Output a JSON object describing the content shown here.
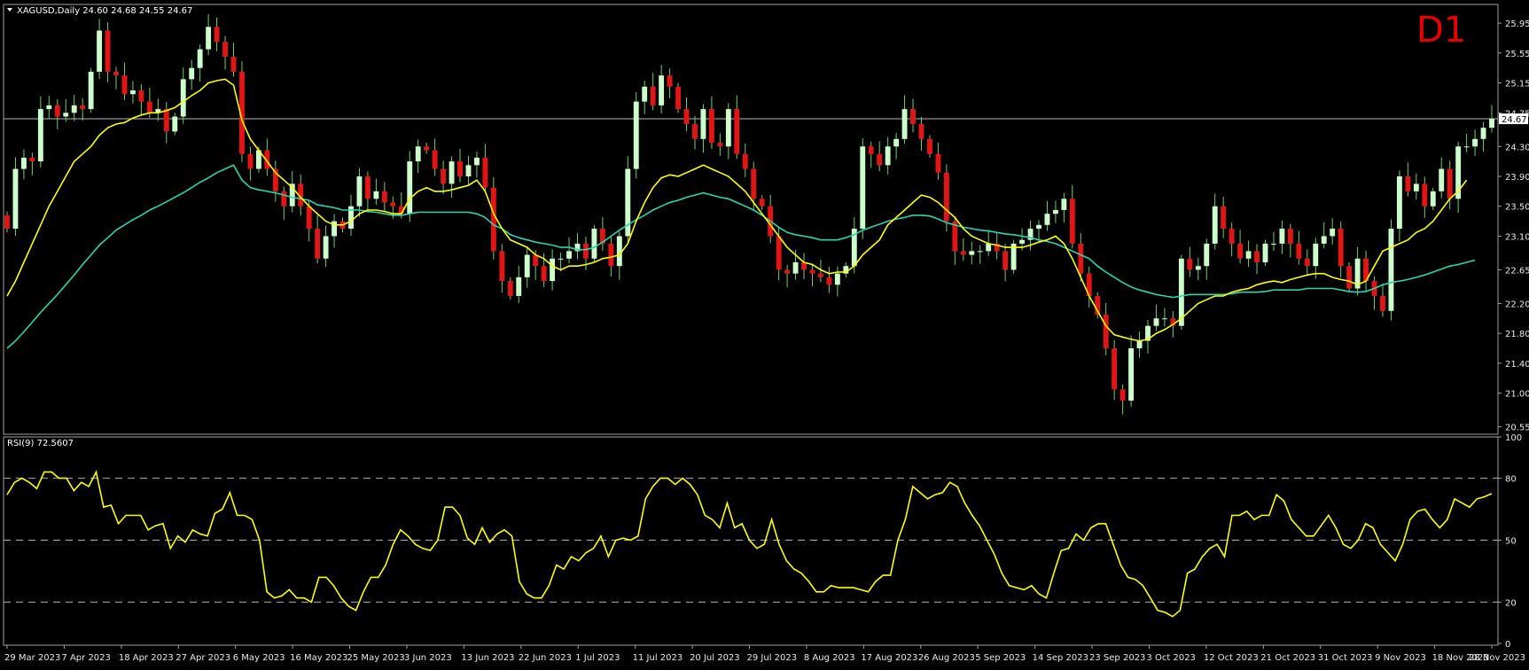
{
  "header": {
    "symbol_line": "XAGUSD,Daily  24.60 24.68 24.55 24.67",
    "timeframe_badge": "D1",
    "rsi_label": "RSI(9) 72.5607",
    "last_price_label": "24.67"
  },
  "colors": {
    "bull_candle": "#ccffcc",
    "bear_candle": "#e31414",
    "wick": "#6fd06f",
    "ma_fast": "#ffff00",
    "ma_slow": "#29d6b0",
    "rsi_line": "#ffff00",
    "frame": "#a0a0a0"
  },
  "chart_data": [
    {
      "type": "candlestick",
      "symbol": "XAGUSD",
      "timeframe": "Daily",
      "ylim": [
        20.45,
        26.2
      ],
      "y_ticks": [
        "25.95",
        "25.55",
        "25.15",
        "24.75",
        "24.30",
        "23.90",
        "23.50",
        "23.10",
        "22.65",
        "22.20",
        "21.80",
        "21.40",
        "21.00",
        "20.55"
      ],
      "last_price": 24.67,
      "x_tick_labels": [
        "29 Mar 2023",
        "7 Apr 2023",
        "18 Apr 2023",
        "27 Apr 2023",
        "6 May 2023",
        "16 May 2023",
        "25 May 2023",
        "3 Jun 2023",
        "13 Jun 2023",
        "22 Jun 2023",
        "1 Jul 2023",
        "11 Jul 2023",
        "20 Jul 2023",
        "29 Jul 2023",
        "8 Aug 2023",
        "17 Aug 2023",
        "26 Aug 2023",
        "5 Sep 2023",
        "14 Sep 2023",
        "23 Sep 2023",
        "3 Oct 2023",
        "12 Oct 2023",
        "21 Oct 2023",
        "31 Oct 2023",
        "9 Nov 2023",
        "18 Nov 2023",
        "28 Nov 2023"
      ],
      "close": [
        23.2,
        24.0,
        24.15,
        24.1,
        24.8,
        24.85,
        24.7,
        24.75,
        24.85,
        24.8,
        25.3,
        25.85,
        25.3,
        25.25,
        25.0,
        25.05,
        24.9,
        24.75,
        24.8,
        24.5,
        24.7,
        25.2,
        25.35,
        25.6,
        25.9,
        25.7,
        25.5,
        25.3,
        24.2,
        24.0,
        24.25,
        24.0,
        23.7,
        23.5,
        23.8,
        23.5,
        23.2,
        22.8,
        23.1,
        23.3,
        23.2,
        23.5,
        23.9,
        23.6,
        23.7,
        23.55,
        23.5,
        23.4,
        24.1,
        24.3,
        24.25,
        24.0,
        23.8,
        24.1,
        23.9,
        24.05,
        24.15,
        23.75,
        22.9,
        22.5,
        22.3,
        22.55,
        22.85,
        22.7,
        22.5,
        22.8,
        22.8,
        22.9,
        23.0,
        22.8,
        23.2,
        23.0,
        22.7,
        23.1,
        24.0,
        24.9,
        25.1,
        24.85,
        25.25,
        25.1,
        24.8,
        24.6,
        24.4,
        24.8,
        24.35,
        24.3,
        24.8,
        24.2,
        24.0,
        23.6,
        23.5,
        23.1,
        22.65,
        22.6,
        22.75,
        22.65,
        22.6,
        22.55,
        22.45,
        22.6,
        22.7,
        23.2,
        24.3,
        24.2,
        24.05,
        24.3,
        24.4,
        24.8,
        24.6,
        24.4,
        24.2,
        23.95,
        23.3,
        22.9,
        22.85,
        22.9,
        22.9,
        23.0,
        22.9,
        22.65,
        23.0,
        23.05,
        23.2,
        23.25,
        23.4,
        23.45,
        23.6,
        23.0,
        22.6,
        22.3,
        22.05,
        21.6,
        21.05,
        20.9,
        21.6,
        21.7,
        21.9,
        22.0,
        22.0,
        21.9,
        22.8,
        22.65,
        22.7,
        23.0,
        23.5,
        23.2,
        23.0,
        22.8,
        22.9,
        22.75,
        23.0,
        23.0,
        23.2,
        23.0,
        22.8,
        22.7,
        23.0,
        23.1,
        23.2,
        22.7,
        22.4,
        22.8,
        22.5,
        22.3,
        22.1,
        23.2,
        23.9,
        23.7,
        23.8,
        23.5,
        23.7,
        24.0,
        23.6,
        24.3,
        24.3,
        24.4,
        24.55,
        24.67
      ],
      "ma_fast_values": [
        22.3,
        22.5,
        22.75,
        23.0,
        23.25,
        23.5,
        23.7,
        23.9,
        24.1,
        24.2,
        24.3,
        24.45,
        24.55,
        24.6,
        24.62,
        24.68,
        24.72,
        24.75,
        24.75,
        24.78,
        24.82,
        24.9,
        24.98,
        25.05,
        25.15,
        25.18,
        25.2,
        25.12,
        24.65,
        24.4,
        24.25,
        24.1,
        23.95,
        23.85,
        23.75,
        23.62,
        23.5,
        23.4,
        23.3,
        23.25,
        23.25,
        23.3,
        23.4,
        23.45,
        23.45,
        23.43,
        23.4,
        23.4,
        23.6,
        23.7,
        23.75,
        23.7,
        23.7,
        23.72,
        23.75,
        23.78,
        23.85,
        23.7,
        23.4,
        23.2,
        23.05,
        23.0,
        22.95,
        22.85,
        22.8,
        22.7,
        22.65,
        22.7,
        22.7,
        22.72,
        22.75,
        22.8,
        22.82,
        22.85,
        23.0,
        23.3,
        23.55,
        23.75,
        23.88,
        23.92,
        23.9,
        23.95,
        24.0,
        24.05,
        24.0,
        23.95,
        23.9,
        23.8,
        23.7,
        23.55,
        23.4,
        23.25,
        23.1,
        22.95,
        22.85,
        22.75,
        22.72,
        22.65,
        22.6,
        22.62,
        22.62,
        22.7,
        22.85,
        22.95,
        23.05,
        23.25,
        23.35,
        23.45,
        23.55,
        23.65,
        23.62,
        23.55,
        23.45,
        23.35,
        23.2,
        23.1,
        23.05,
        23.0,
        22.98,
        22.95,
        22.95,
        22.95,
        22.98,
        23.02,
        23.05,
        23.1,
        23.0,
        22.8,
        22.55,
        22.3,
        22.1,
        21.9,
        21.78,
        21.75,
        21.72,
        21.7,
        21.72,
        21.8,
        21.85,
        21.92,
        22.0,
        22.1,
        22.2,
        22.25,
        22.3,
        22.3,
        22.35,
        22.38,
        22.4,
        22.45,
        22.48,
        22.5,
        22.48,
        22.52,
        22.55,
        22.58,
        22.6,
        22.6,
        22.55,
        22.52,
        22.5,
        22.45,
        22.5,
        22.7,
        22.9,
        22.95,
        23.0,
        23.05,
        23.15,
        23.2,
        23.3,
        23.45,
        23.6,
        23.7,
        23.85
      ],
      "ma_slow_values": [
        21.6,
        21.7,
        21.82,
        21.95,
        22.08,
        22.2,
        22.32,
        22.45,
        22.58,
        22.72,
        22.85,
        22.98,
        23.08,
        23.18,
        23.25,
        23.32,
        23.38,
        23.45,
        23.5,
        23.56,
        23.62,
        23.68,
        23.75,
        23.82,
        23.88,
        23.95,
        24.0,
        24.05,
        23.85,
        23.75,
        23.72,
        23.7,
        23.68,
        23.65,
        23.62,
        23.6,
        23.58,
        23.52,
        23.5,
        23.48,
        23.45,
        23.45,
        23.45,
        23.43,
        23.42,
        23.4,
        23.38,
        23.38,
        23.4,
        23.42,
        23.42,
        23.42,
        23.42,
        23.42,
        23.42,
        23.42,
        23.4,
        23.35,
        23.25,
        23.2,
        23.12,
        23.08,
        23.05,
        23.02,
        23.0,
        22.98,
        22.95,
        22.95,
        22.92,
        22.92,
        22.95,
        23.02,
        23.1,
        23.18,
        23.25,
        23.32,
        23.38,
        23.45,
        23.5,
        23.55,
        23.58,
        23.62,
        23.65,
        23.68,
        23.65,
        23.62,
        23.6,
        23.55,
        23.5,
        23.45,
        23.38,
        23.3,
        23.22,
        23.15,
        23.12,
        23.1,
        23.08,
        23.05,
        23.05,
        23.05,
        23.08,
        23.12,
        23.18,
        23.22,
        23.26,
        23.3,
        23.33,
        23.35,
        23.38,
        23.38,
        23.37,
        23.33,
        23.28,
        23.25,
        23.22,
        23.2,
        23.18,
        23.17,
        23.15,
        23.13,
        23.12,
        23.1,
        23.08,
        23.05,
        23.03,
        23.0,
        22.95,
        22.9,
        22.85,
        22.8,
        22.7,
        22.62,
        22.55,
        22.48,
        22.42,
        22.38,
        22.35,
        22.32,
        22.3,
        22.28,
        22.3,
        22.32,
        22.32,
        22.32,
        22.32,
        22.32,
        22.33,
        22.35,
        22.35,
        22.35,
        22.36,
        22.38,
        22.38,
        22.38,
        22.38,
        22.4,
        22.4,
        22.4,
        22.4,
        22.38,
        22.36,
        22.35,
        22.36,
        22.4,
        22.45,
        22.48,
        22.5,
        22.52,
        22.55,
        22.58,
        22.62,
        22.66,
        22.7,
        22.72,
        22.75,
        22.78
      ]
    },
    {
      "type": "line",
      "indicator": "RSI",
      "period": 9,
      "current": 72.5607,
      "ylim": [
        0,
        100
      ],
      "y_ticks": [
        100,
        80,
        50,
        20,
        0
      ],
      "levels": [
        80,
        50,
        20
      ],
      "values": [
        72,
        78,
        80,
        78,
        75,
        83,
        83,
        80,
        80,
        74,
        78,
        76,
        83,
        66,
        67,
        58,
        62,
        62,
        62,
        55,
        57,
        58,
        46,
        52,
        49,
        55,
        53,
        52,
        63,
        65,
        73,
        62,
        62,
        60,
        50,
        25,
        22,
        23,
        26,
        22,
        22,
        20,
        32,
        32,
        28,
        22,
        18,
        16,
        25,
        32,
        32,
        38,
        48,
        55,
        52,
        48,
        46,
        45,
        50,
        66,
        66,
        62,
        51,
        48,
        56,
        49,
        53,
        55,
        52,
        30,
        24,
        22,
        22,
        28,
        38,
        36,
        42,
        40,
        44,
        46,
        52,
        42,
        50,
        51,
        50,
        52,
        70,
        76,
        80,
        80,
        77,
        80,
        77,
        72,
        62,
        60,
        56,
        68,
        56,
        58,
        50,
        46,
        48,
        60,
        48,
        40,
        36,
        34,
        30,
        25,
        25,
        28,
        27,
        27,
        27,
        26,
        25,
        30,
        33,
        33,
        50,
        60,
        76,
        73,
        70,
        72,
        73,
        78,
        76,
        68,
        62,
        57,
        50,
        43,
        34,
        28,
        27,
        26,
        28,
        24,
        22,
        34,
        45,
        46,
        53,
        50,
        56,
        58,
        58,
        48,
        38,
        32,
        31,
        28,
        22,
        16,
        15,
        13,
        16,
        34,
        36,
        42,
        46,
        48,
        42,
        62,
        62,
        64,
        60,
        62,
        62,
        72,
        69,
        60,
        56,
        52,
        52,
        57,
        62,
        56,
        48,
        46,
        50,
        58,
        56,
        48,
        44,
        40,
        48,
        60,
        64,
        65,
        60,
        56,
        60,
        70,
        68,
        66,
        70,
        71,
        72.56
      ]
    }
  ]
}
